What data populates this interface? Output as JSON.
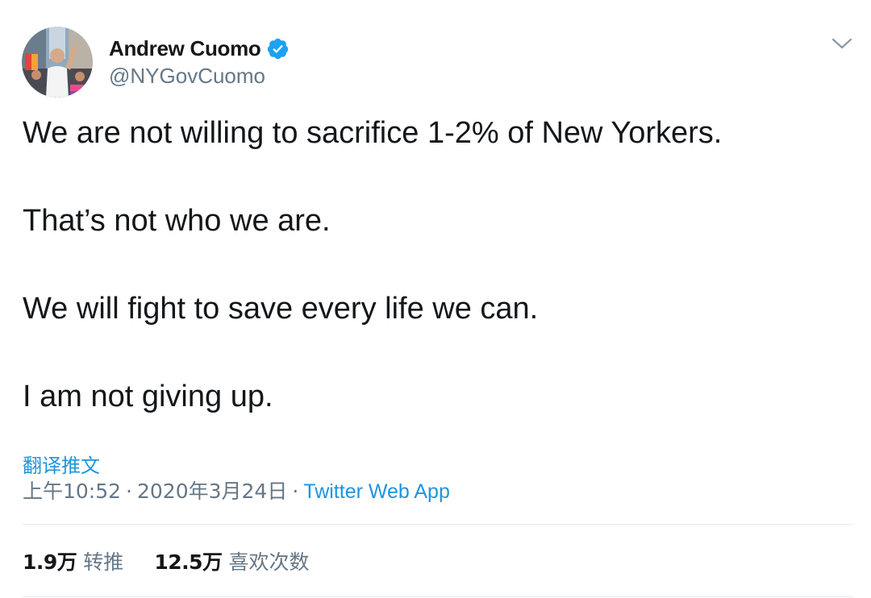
{
  "author": {
    "display_name": "Andrew Cuomo",
    "handle": "@NYGovCuomo",
    "verified": true
  },
  "tweet": {
    "paragraphs": [
      "We are not willing to sacrifice 1-2% of New Yorkers.",
      "That’s not who we are.",
      "We will fight to save every life we can.",
      "I am not giving up."
    ],
    "translate_label": "翻译推文",
    "time": "上午10:52",
    "date": "2020年3月24日",
    "separator": "·",
    "source": "Twitter Web App"
  },
  "stats": {
    "retweets_count": "1.9万",
    "retweets_label": "转推",
    "likes_count": "12.5万",
    "likes_label": "喜欢次数"
  },
  "colors": {
    "accent": "#1b95e0",
    "verified": "#1da1f2",
    "text_primary": "#14171a",
    "text_secondary": "#657786",
    "divider": "#e6ecf0"
  },
  "icons": {
    "verified": "verified-badge-icon",
    "more": "chevron-down-icon"
  }
}
